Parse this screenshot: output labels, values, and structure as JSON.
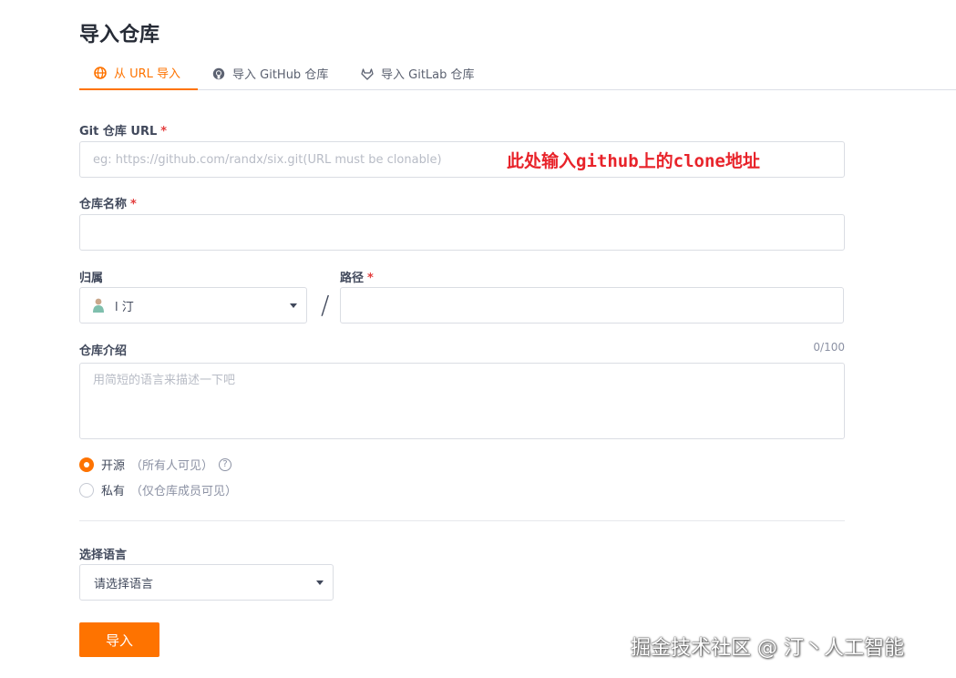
{
  "page_title": "导入仓库",
  "tabs": [
    {
      "label": "从 URL 导入",
      "icon": "globe-icon",
      "active": true
    },
    {
      "label": "导入 GitHub 仓库",
      "icon": "github-icon",
      "active": false
    },
    {
      "label": "导入 GitLab 仓库",
      "icon": "gitlab-icon",
      "active": false
    }
  ],
  "git_url": {
    "label": "Git 仓库 URL",
    "required_mark": "*",
    "placeholder": "eg: https://github.com/randx/six.git(URL must be clonable)",
    "value": ""
  },
  "annotation": "此处输入github上的clone地址",
  "repo_name": {
    "label": "仓库名称",
    "required_mark": "*",
    "value": ""
  },
  "owner": {
    "label": "归属",
    "value": "l 汀"
  },
  "path": {
    "label": "路径",
    "required_mark": "*",
    "value": ""
  },
  "separator": "/",
  "description": {
    "label": "仓库介绍",
    "counter": "0/100",
    "placeholder": "用简短的语言来描述一下吧",
    "value": ""
  },
  "visibility": {
    "public": {
      "label": "开源",
      "hint": "（所有人可见）",
      "help": "?",
      "selected": true
    },
    "private": {
      "label": "私有",
      "hint": "（仅仓库成员可见）",
      "selected": false
    }
  },
  "language": {
    "label": "选择语言",
    "value": "请选择语言"
  },
  "submit_label": "导入",
  "watermark": "掘金技术社区 @ 汀丶人工智能",
  "colors": {
    "accent": "#fe7300",
    "required": "#e33c3c",
    "annotation": "#e8232a"
  }
}
